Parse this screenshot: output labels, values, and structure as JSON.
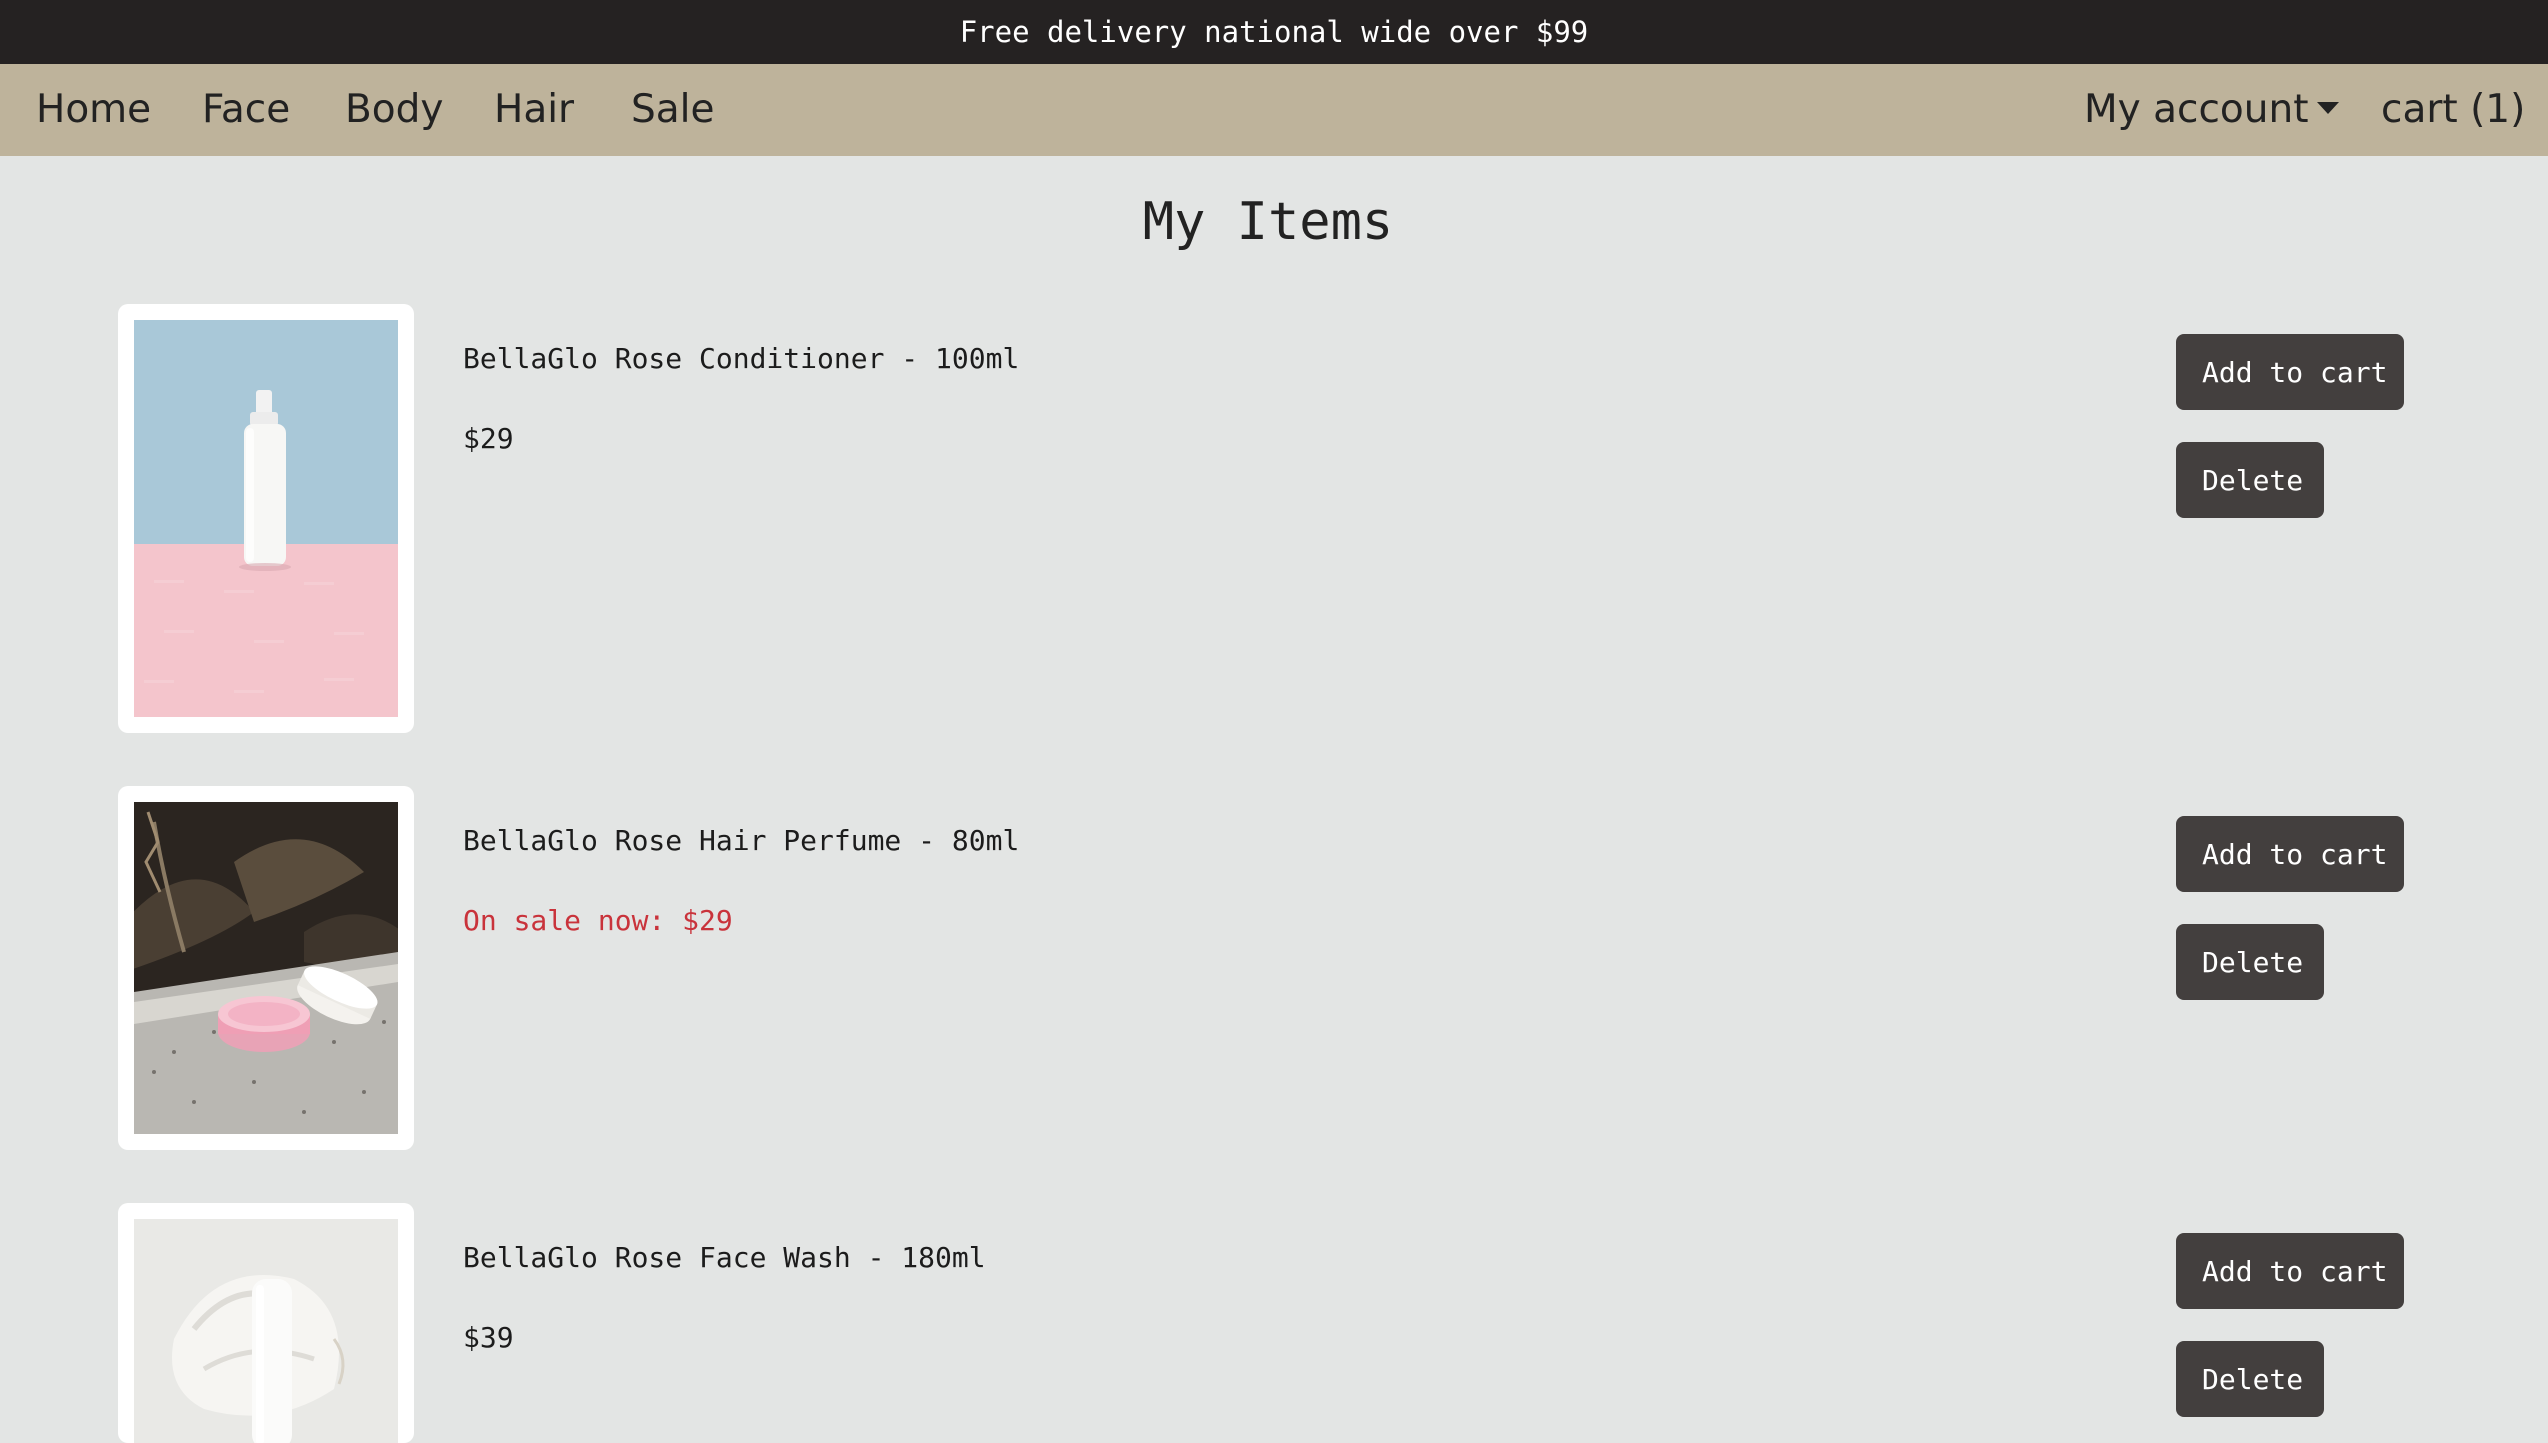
{
  "announcement": "Free delivery national wide over $99",
  "nav": {
    "links": [
      "Home",
      "Face",
      "Body",
      "Hair",
      "Sale"
    ],
    "account_label": "My account",
    "cart_label": "cart (1)"
  },
  "page_title": "My Items",
  "items": [
    {
      "name": "BellaGlo Rose Conditioner - 100ml",
      "price": "$29",
      "on_sale": false,
      "add_label": "Add to cart",
      "delete_label": "Delete"
    },
    {
      "name": "BellaGlo Rose Hair Perfume - 80ml",
      "price": "On sale now: $29",
      "on_sale": true,
      "add_label": "Add to cart",
      "delete_label": "Delete"
    },
    {
      "name": "BellaGlo Rose Face Wash - 180ml",
      "price": "$39",
      "on_sale": false,
      "add_label": "Add to cart",
      "delete_label": "Delete"
    }
  ],
  "colors": {
    "announcement_bg": "#252222",
    "nav_bg": "#beb39b",
    "page_bg": "#e3e5e4",
    "button_bg": "#433f3e",
    "sale_text": "#c9333b"
  }
}
